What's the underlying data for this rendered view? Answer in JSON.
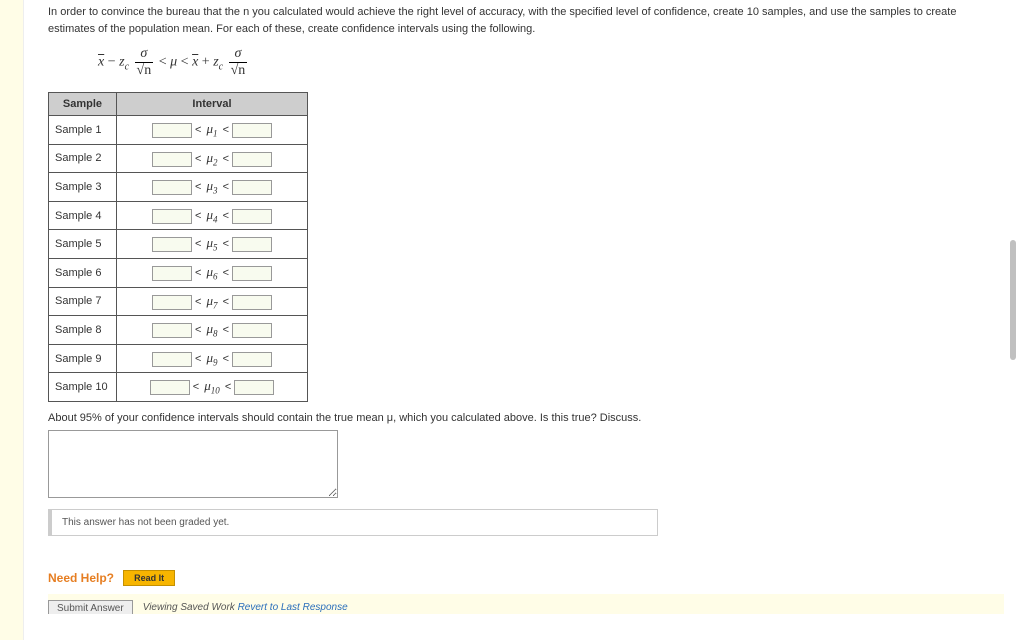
{
  "instruction": "In order to convince the bureau that the n you calculated would achieve the right level of accuracy, with the specified level of confidence, create 10 samples, and use the samples to create estimates of the population mean. For each of these, create confidence intervals using the following.",
  "formula_parts": {
    "x1": "x",
    "minus": " − ",
    "z1": "z",
    "c": "c",
    "sigma": "σ",
    "rootn": "√n",
    "lt1": " < ",
    "mu": "μ",
    "lt2": " < ",
    "x2": "x",
    "plus": " + ",
    "z2": "z"
  },
  "table": {
    "headers": {
      "sample": "Sample",
      "interval": "Interval"
    },
    "rows": [
      {
        "label": "Sample 1",
        "sub": "1"
      },
      {
        "label": "Sample 2",
        "sub": "2"
      },
      {
        "label": "Sample 3",
        "sub": "3"
      },
      {
        "label": "Sample 4",
        "sub": "4"
      },
      {
        "label": "Sample 5",
        "sub": "5"
      },
      {
        "label": "Sample 6",
        "sub": "6"
      },
      {
        "label": "Sample 7",
        "sub": "7"
      },
      {
        "label": "Sample 8",
        "sub": "8"
      },
      {
        "label": "Sample 9",
        "sub": "9"
      },
      {
        "label": "Sample 10",
        "sub": "10"
      }
    ]
  },
  "discuss_prompt": "About 95% of your confidence intervals should contain the true mean μ, which you calculated above. Is this true? Discuss.",
  "not_graded": "This answer has not been graded yet.",
  "need_help": {
    "label": "Need Help?",
    "readit": "Read It"
  },
  "footer": {
    "submit": "Submit Answer",
    "viewing": "Viewing Saved Work",
    "revert": "Revert to Last Response"
  },
  "lt_symbol": "<",
  "mu_char": "μ"
}
